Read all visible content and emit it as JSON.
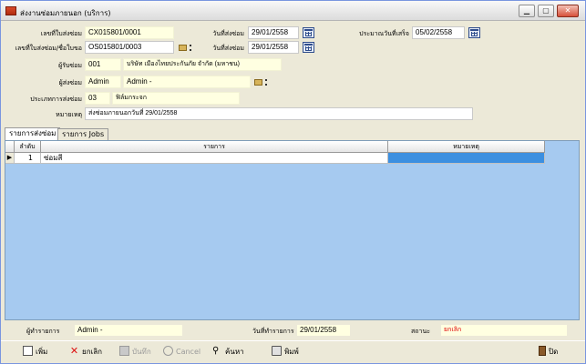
{
  "window": {
    "title": "ส่งงานซ่อมภายนอก (บริการ)"
  },
  "form": {
    "repair_no": {
      "label": "เลขที่ใบส่งซ่อม",
      "value": "CX015801/0001"
    },
    "repair_date": {
      "label": "วันที่ส่งซ่อม",
      "value": "29/01/2558"
    },
    "est_finish": {
      "label": "ประมาณวันที่เสร็จ",
      "value": "05/02/2558"
    },
    "request_no": {
      "label": "เลขที่ใบส่งซ่อม/ชื่อใบขอ",
      "value": "OS015801/0003"
    },
    "request_date": {
      "label": "วันที่ส่งซ่อม",
      "value": "29/01/2558"
    },
    "receiver": {
      "label": "ผู้รับซ่อม",
      "code": "001",
      "name": "บริษัท เมืองไทยประกันภัย จำกัด (มหาชน)"
    },
    "sender": {
      "label": "ผู้ส่งซ่อม",
      "code": "Admin",
      "name": "Admin -"
    },
    "repair_type": {
      "label": "ประเภทการส่งซ่อม",
      "code": "03",
      "name": "ฟิล์มกระจก"
    },
    "remark": {
      "label": "หมายเหตุ",
      "value": "ส่งซ่อมภายนอกวันที่ 29/01/2558"
    }
  },
  "tabs": [
    "รายการส่งซ่อม",
    "รายการ Jobs"
  ],
  "grid": {
    "columns": [
      "ลำดับ",
      "รายการ",
      "หมายเหตุ"
    ],
    "rows": [
      {
        "no": "1",
        "item": "ซ่อมสี",
        "remark": ""
      }
    ]
  },
  "status": {
    "operator_label": "ผู้ทำรายการ",
    "operator": "Admin -",
    "date_label": "วันที่ทำรายการ",
    "date": "29/01/2558",
    "state_label": "สถานะ",
    "state": "ยกเลิก",
    "state_color": "#e00000"
  },
  "toolbar": {
    "add": "เพิ่ม",
    "cancel_doc": "ยกเลิก",
    "save": "บันทึก",
    "cancel": "Cancel",
    "search": "ค้นหา",
    "print": "พิมพ์",
    "close": "ปิด"
  }
}
